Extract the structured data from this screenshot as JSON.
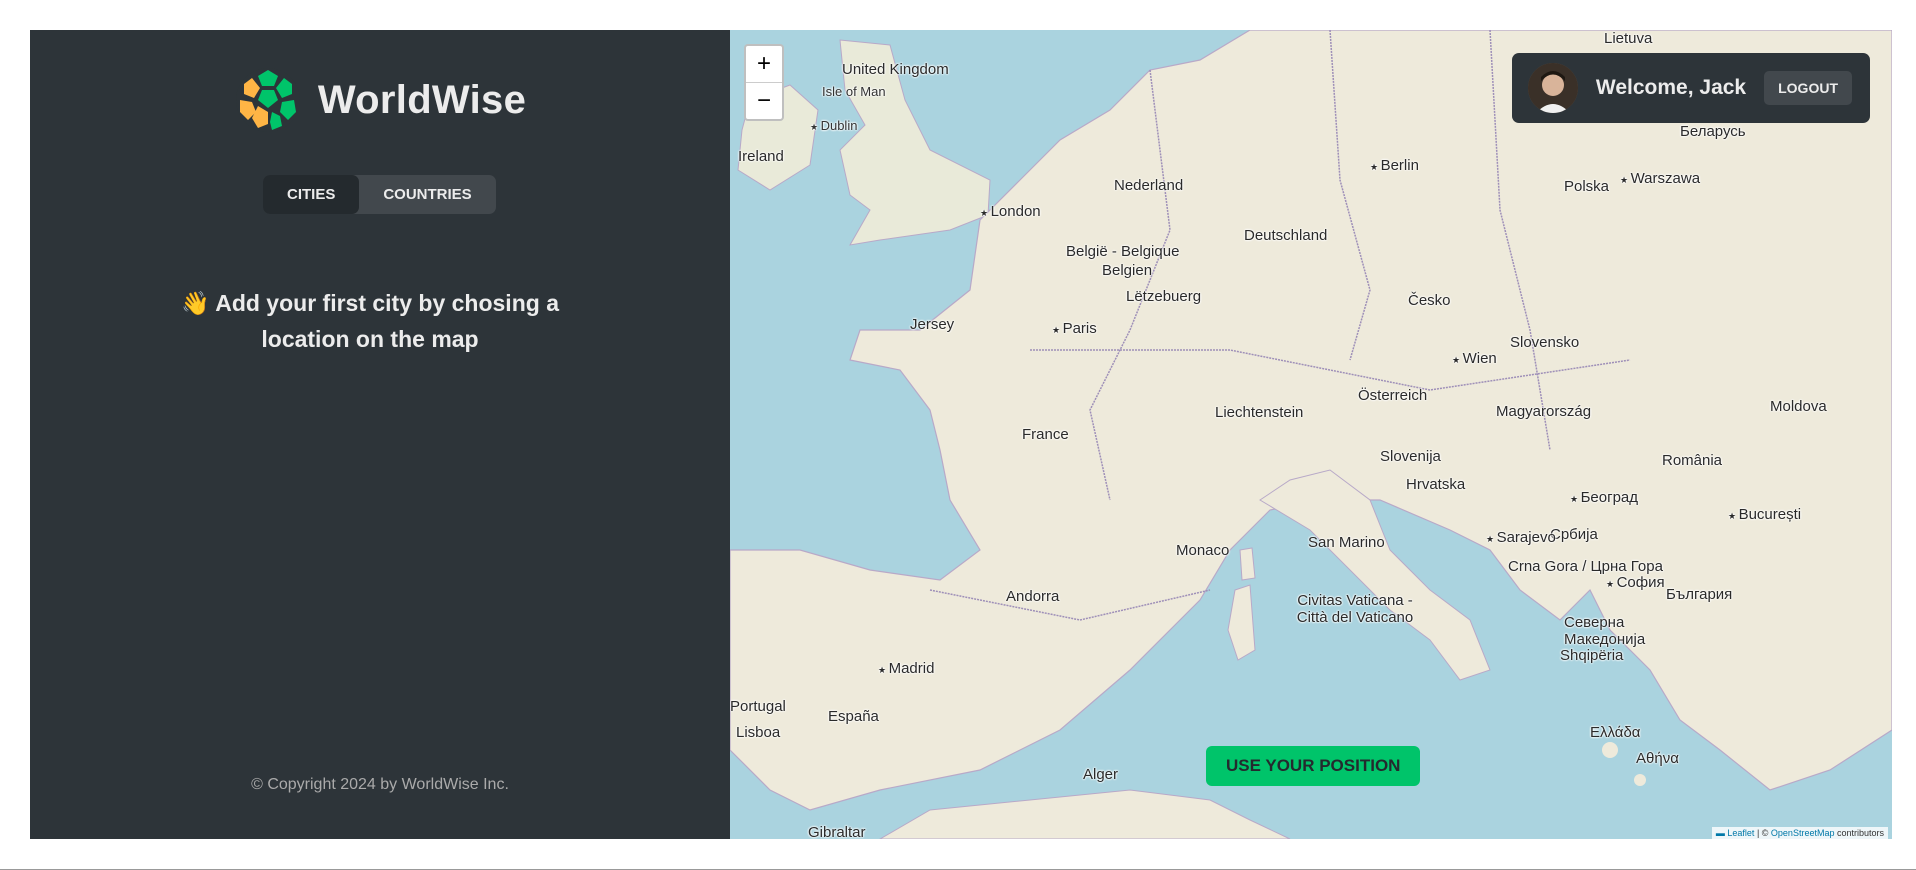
{
  "app": {
    "name": "WorldWise",
    "colors": {
      "sidebar": "#2d3439",
      "brand_green": "#00c46a",
      "brand_yellow": "#ffb545",
      "text": "#ececec"
    }
  },
  "sidebar": {
    "tabs": [
      {
        "label": "CITIES",
        "active": true
      },
      {
        "label": "COUNTRIES",
        "active": false
      }
    ],
    "empty_emoji": "👋",
    "empty_message": "Add your first city by chosing a location on the map",
    "copyright": "© Copyright 2024 by WorldWise Inc."
  },
  "user": {
    "welcome": "Welcome, Jack",
    "logout_label": "LOGOUT"
  },
  "map": {
    "zoom_in": "+",
    "zoom_out": "−",
    "use_position_label": "USE YOUR POSITION",
    "attribution": {
      "leaflet": "Leaflet",
      "separator": " | © ",
      "osm": "OpenStreetMap",
      "suffix": " contributors"
    },
    "labels": {
      "united_kingdom": "United Kingdom",
      "isle_of_man": "Isle of Man",
      "dublin": "Dublin",
      "ireland": "Ireland",
      "london": "London",
      "nederland": "Nederland",
      "berlin": "Berlin",
      "polska": "Polska",
      "warszawa": "Warszawa",
      "deutschland": "Deutschland",
      "belgie": "België - Belgique",
      "belgien": "Belgien",
      "letzebuerg": "Lëtzebuerg",
      "jersey": "Jersey",
      "paris": "Paris",
      "cesko": "Česko",
      "wien": "Wien",
      "slovensko": "Slovensko",
      "liechtenstein": "Liechtenstein",
      "osterreich": "Österreich",
      "magyarorszag": "Magyarország",
      "france": "France",
      "slovenija": "Slovenija",
      "hrvatska": "Hrvatska",
      "romania": "România",
      "moldova": "Moldova",
      "beograd": "Београд",
      "srbija": "Србија",
      "bucuresti": "București",
      "sarajevo": "Sarajevo",
      "monaco": "Monaco",
      "san_marino": "San Marino",
      "crna_gora": "Crna Gora / Црна Гора",
      "sofia": "София",
      "bulgaria": "България",
      "andorra": "Andorra",
      "vaticano": "Civitas Vaticana - Città del Vaticano",
      "severna": "Северна Македонија",
      "shqiperia": "Shqipëria",
      "madrid": "Madrid",
      "espana": "España",
      "portugal": "Portugal",
      "lisboa": "Lisboa",
      "ellada": "Ελλάδα",
      "athina": "Αθήνα",
      "alger": "Alger",
      "gibraltar": "Gibraltar",
      "lietuva": "Lietuva",
      "belarus": "Беларусь"
    }
  }
}
